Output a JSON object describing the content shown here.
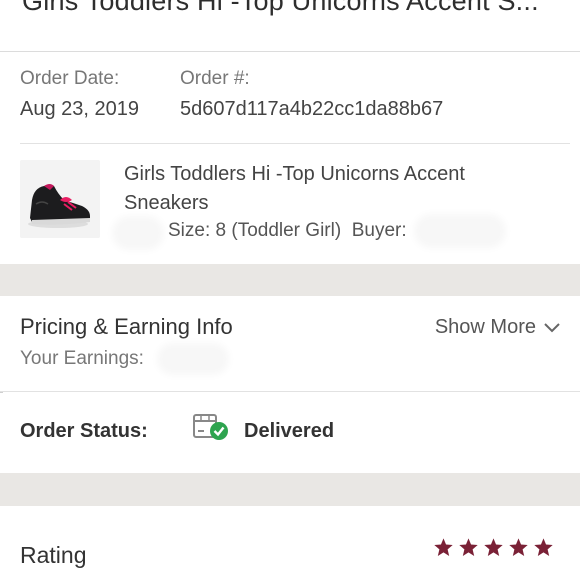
{
  "header": {
    "title": "Girls Toddlers Hi -Top Unicorns Accent S..."
  },
  "order": {
    "date_label": "Order Date:",
    "date_value": "Aug 23, 2019",
    "number_label": "Order #:",
    "number_value": "5d607d117a4b22cc1da88b67"
  },
  "item": {
    "title": "Girls Toddlers Hi -Top Unicorns Accent Sneakers",
    "size_text": "Size: 8 (Toddler Girl)",
    "buyer_label": "Buyer:",
    "image_icon": "sneaker-image"
  },
  "pricing": {
    "title": "Pricing & Earning Info",
    "show_more": "Show More",
    "earnings_label": "Your Earnings:"
  },
  "status": {
    "label": "Order Status:",
    "value": "Delivered",
    "icon": "package-delivered-icon",
    "check_color": "#2ea44f"
  },
  "rating": {
    "label": "Rating",
    "stars": 5,
    "max_stars": 5,
    "star_color": "#7a2136"
  }
}
